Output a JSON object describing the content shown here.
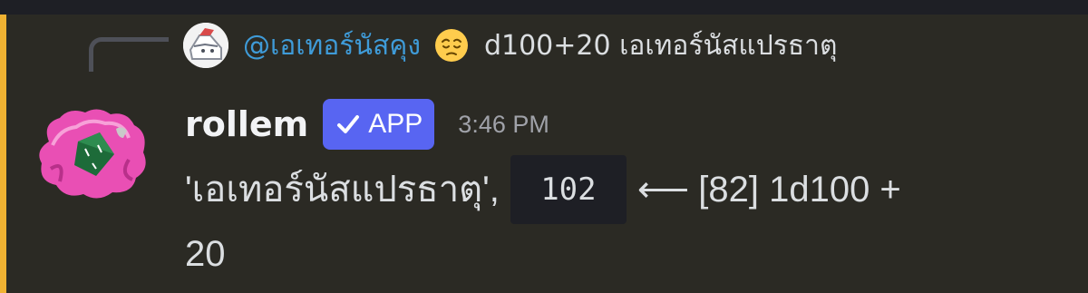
{
  "reply": {
    "username": "@เอเทอร์นัสคุง",
    "emoji": "pensive-face-emoji",
    "content": "d100+20 เอเทอร์นัสแปรธาตุ"
  },
  "message": {
    "username": "rollem",
    "badge": "APP",
    "timestamp": "3:46 PM",
    "body_prefix": "'เอเทอร์นัสแปรธาตุ',",
    "result": "102",
    "arrow": "⟵",
    "breakdown": "[82] 1d100 +",
    "breakdown_cont": "20"
  },
  "colors": {
    "accent": "#5865f2",
    "highlight": "#f0b232",
    "mention": "#3f9bd8"
  }
}
